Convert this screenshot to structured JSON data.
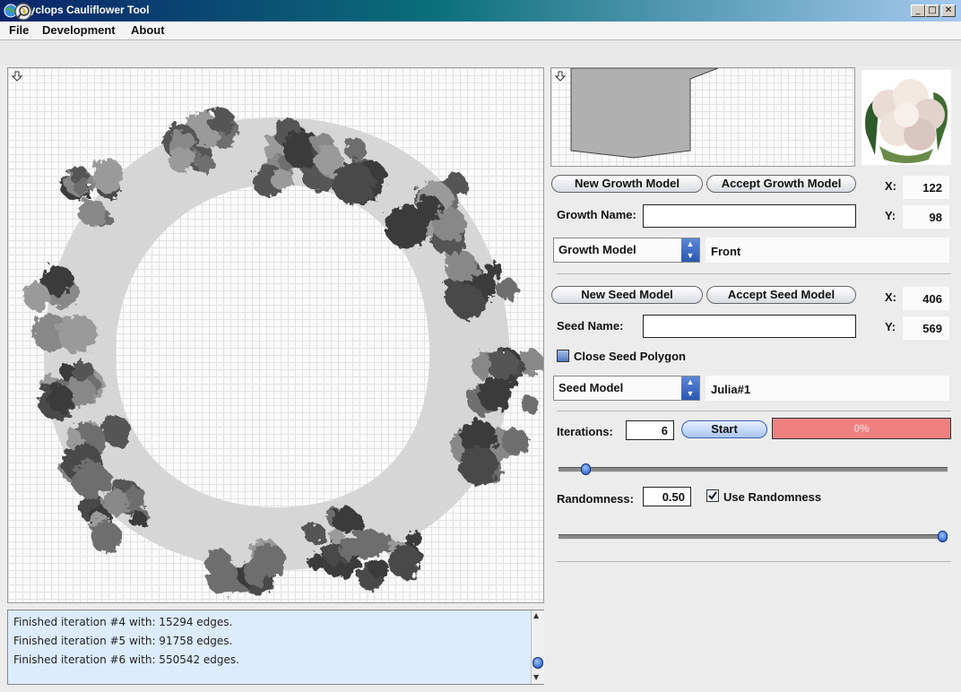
{
  "window": {
    "title": "Cyclops Cauliflower Tool",
    "minimize": "_",
    "maximize": "□",
    "close": "✕"
  },
  "menu": [
    "File",
    "Development",
    "About"
  ],
  "growth": {
    "new_button": "New Growth Model",
    "accept_button": "Accept Growth Model",
    "name_label": "Growth Name:",
    "name_value": "",
    "model_select": "Growth Model",
    "model_value": "Front",
    "x_label": "X:",
    "x_value": "122",
    "y_label": "Y:",
    "y_value": "98"
  },
  "seed": {
    "new_button": "New Seed Model",
    "accept_button": "Accept Seed Model",
    "name_label": "Seed Name:",
    "name_value": "",
    "close_polygon_label": "Close Seed Polygon",
    "close_polygon_checked": false,
    "model_select": "Seed Model",
    "model_value": "Julia#1",
    "x_label": "X:",
    "x_value": "406",
    "y_label": "Y:",
    "y_value": "569"
  },
  "iterations": {
    "label": "Iterations:",
    "value": "6",
    "start_button": "Start",
    "progress_text": "0%",
    "progress": 0,
    "slider_level": 0.06
  },
  "randomness": {
    "label": "Randomness:",
    "value": "0.50",
    "use_label": "Use Randomness",
    "use_checked": true,
    "slider_level": 1.0
  },
  "log": [
    "Finished iteration #4 with: 15294 edges.",
    "Finished iteration #5 with: 91758 edges.",
    "Finished iteration #6 with: 550542 edges."
  ],
  "colors": {
    "progress_bg": "#f08080",
    "progress_text": "#f8c8c8",
    "log_bg": "#dcecfc",
    "accent": "#2a57b0"
  }
}
